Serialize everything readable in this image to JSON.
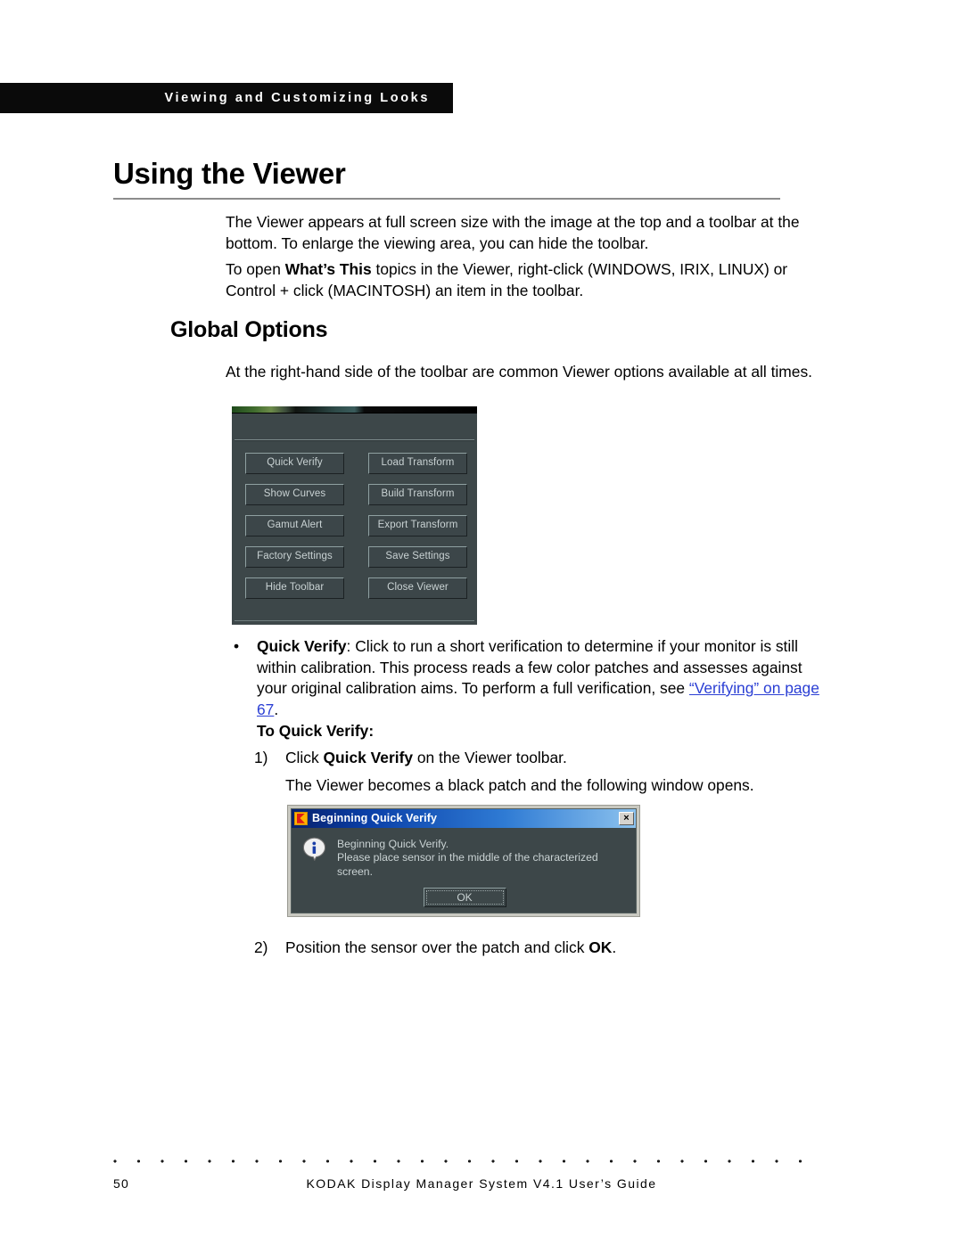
{
  "running_header": {
    "text": "Viewing and Customizing Looks"
  },
  "page_title": "Using the Viewer",
  "intro": {
    "paragraph_1_part1": "The Viewer appears at full screen size with the image at the top and a toolbar at the bottom. To enlarge the viewing area, you can hide the toolbar.",
    "paragraph_2_pre": "To open ",
    "paragraph_2_bold": "What’s This",
    "paragraph_2_post": " topics in the Viewer, right-click (WINDOWS, IRIX, LINUX) or Control + click (MACINTOSH) an item in the toolbar."
  },
  "section": {
    "heading": "Global Options",
    "paragraph": "At the right-hand side of the toolbar are common Viewer options available at all times."
  },
  "toolbar_screenshot": {
    "left_column": [
      "Quick Verify",
      "Show Curves",
      "Gamut Alert",
      "Factory Settings",
      "Hide Toolbar"
    ],
    "right_column": [
      "Load Transform",
      "Build Transform",
      "Export Transform",
      "Save Settings",
      "Close Viewer"
    ],
    "background_color": "#3d4749",
    "button_text_color": "#c9d2d3"
  },
  "bullet": {
    "marker": "•",
    "term": "Quick Verify",
    "text_pre": ": Click to run a short verification to determine if your monitor is still within calibration. This process reads a few color patches and assesses against your original calibration aims. To perform a full verification, see ",
    "link": "“Verifying” on page 67",
    "text_post": ".",
    "link_color": "#2b3fd4"
  },
  "procedure": {
    "subheading": "To Quick Verify:",
    "step1_num": "1)",
    "step1_pre": "Click ",
    "step1_bold": "Quick Verify",
    "step1_post": " on the Viewer toolbar.",
    "step1_followup": "The Viewer becomes a black patch and the following window opens.",
    "step2_num": "2)",
    "step2_pre": "Position the sensor over the patch and click ",
    "step2_bold": "OK",
    "step2_post": "."
  },
  "dialog_screenshot": {
    "title": "Beginning Quick Verify",
    "close_label": "×",
    "message_line1": "Beginning Quick Verify.",
    "message_line2": "Please place sensor in the middle of the characterized screen.",
    "ok_label": "OK",
    "titlebar_color": "#0a3fa8",
    "body_color": "#3d4749"
  },
  "footer": {
    "page_number": "50",
    "guide_title": "KODAK Display Manager System V4.1 User’s Guide"
  }
}
